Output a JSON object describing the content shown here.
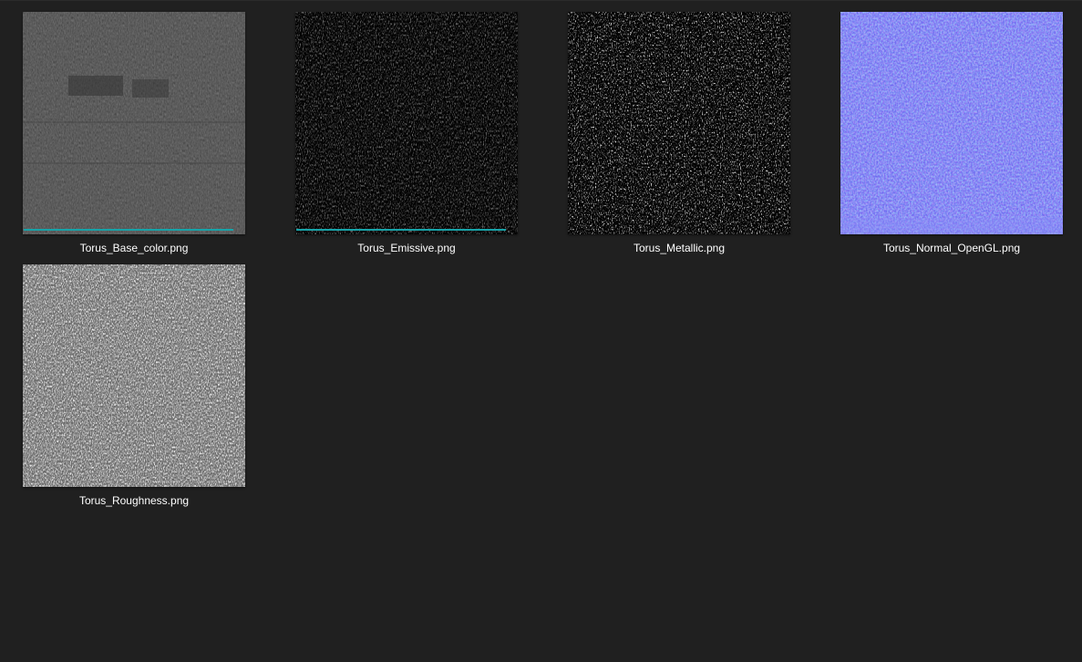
{
  "explorer": {
    "background": "#202020",
    "items": [
      {
        "name": "Torus_Base_color.png",
        "thumbnail": "base-color-texture",
        "sync_indicator": true,
        "sync_color": "#17a3a8"
      },
      {
        "name": "Torus_Emissive.png",
        "thumbnail": "emissive-texture",
        "sync_indicator": true,
        "sync_color": "#17a3a8"
      },
      {
        "name": "Torus_Metallic.png",
        "thumbnail": "metallic-texture",
        "sync_indicator": false
      },
      {
        "name": "Torus_Normal_OpenGL.png",
        "thumbnail": "normal-map-texture",
        "sync_indicator": false
      },
      {
        "name": "Torus_Roughness.png",
        "thumbnail": "roughness-texture",
        "sync_indicator": false
      }
    ]
  }
}
